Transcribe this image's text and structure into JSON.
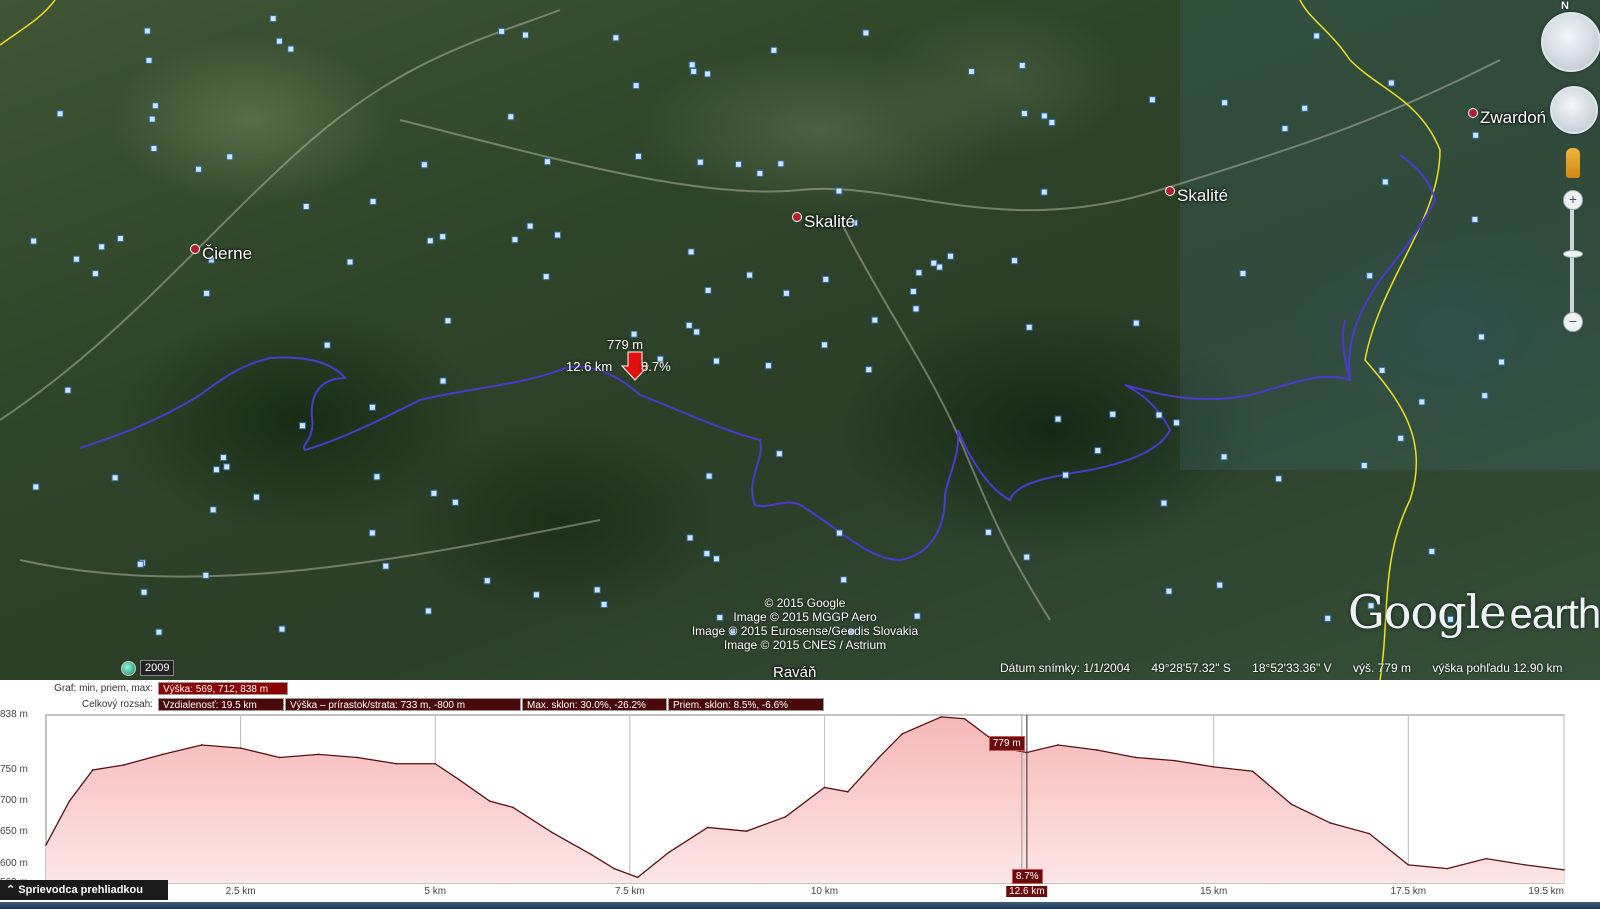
{
  "map": {
    "places": [
      {
        "name": "Čierne"
      },
      {
        "name": "Skalité"
      },
      {
        "name": "Skalité"
      },
      {
        "name": "Zwardoń"
      },
      {
        "name": "Raváň"
      }
    ],
    "marker": {
      "elevation": "779 m",
      "distance": "12.6 km",
      "slope": "8.7%"
    },
    "credits": [
      "© 2015 Google",
      "Image © 2015 MGGP Aero",
      "Image © 2015 Eurosense/Geodis Slovakia",
      "Image © 2015 CNES / Astrium"
    ],
    "logo": {
      "word1": "Google",
      "word2": "earth"
    },
    "year": "2009",
    "north": "N",
    "status": {
      "date": "Dátum snímky: 1/1/2004",
      "lat": "49°28'57.32\" S",
      "lon": "18°52'33.36\" V",
      "elev": "výš.   779 m",
      "eye": "výška pohľadu  12.90 km"
    },
    "colors": {
      "route": "#4a3ad0",
      "border": "#f0e020",
      "marker": "#e01010"
    },
    "controls": {
      "zoom_in": "+",
      "zoom_out": "−"
    }
  },
  "profile": {
    "summary": {
      "graph_caption": "Graf: min, priem, max:",
      "height_cell": "Výška: 569, 712, 838 m",
      "range_caption": "Celkový rozsah:",
      "distance_cell": "Vzdialenosť: 19.5 km",
      "gain_cell": "Výška – prírastok/strata: 733 m, -800 m",
      "maxslope_cell": "Max. sklon: 30.0%, -26.2%",
      "avgslope_cell": "Priem. sklon: 8.5%, -6.6%"
    },
    "cursor": {
      "elevation": "779 m",
      "slope": "8.7%",
      "distance": "12.6 km"
    },
    "tour_button": "Sprievodca prehliadkou",
    "colors": {
      "line": "#5a1010",
      "fill_top": "#f6b8b8",
      "fill_bottom": "#fde6e6"
    }
  },
  "chart_data": {
    "type": "area",
    "xlabel": "",
    "ylabel": "",
    "xlim": [
      0,
      19.5
    ],
    "ylim": [
      569,
      838
    ],
    "xticks": [
      2.5,
      5,
      7.5,
      10,
      12.6,
      15,
      17.5,
      19.5
    ],
    "xtick_labels": [
      "2.5 km",
      "5 km",
      "7.5 km",
      "10 km",
      "12.6 km",
      "15 km",
      "17.5 km",
      "19.5 km"
    ],
    "yticks": [
      569,
      600,
      650,
      700,
      750,
      838
    ],
    "ytick_labels": [
      "569 m",
      "600 m",
      "650 m",
      "700 m",
      "750 m",
      "838 m"
    ],
    "x": [
      0,
      0.3,
      0.6,
      1.0,
      1.5,
      2.0,
      2.5,
      3.0,
      3.5,
      4.0,
      4.5,
      5.0,
      5.3,
      5.7,
      6.0,
      6.5,
      7.0,
      7.3,
      7.6,
      8.0,
      8.5,
      9.0,
      9.5,
      10.0,
      10.3,
      10.7,
      11.0,
      11.5,
      11.8,
      12.3,
      12.6,
      13.0,
      13.5,
      14.0,
      14.5,
      15.0,
      15.5,
      16.0,
      16.5,
      17.0,
      17.5,
      18.0,
      18.5,
      19.0,
      19.5
    ],
    "series": [
      {
        "values": [
          630,
          700,
          750,
          758,
          775,
          790,
          785,
          770,
          775,
          770,
          760,
          760,
          735,
          700,
          690,
          650,
          615,
          592,
          578,
          618,
          658,
          652,
          675,
          722,
          715,
          770,
          808,
          835,
          832,
          785,
          778,
          790,
          782,
          770,
          765,
          755,
          748,
          695,
          665,
          648,
          598,
          592,
          608,
          598,
          590
        ]
      }
    ]
  }
}
